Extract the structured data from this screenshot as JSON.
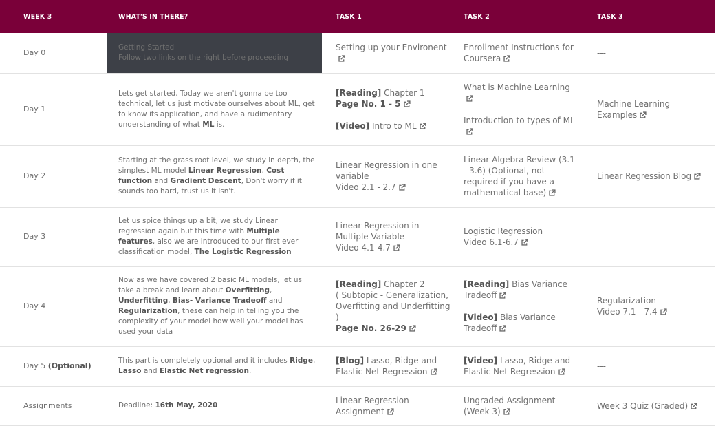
{
  "header": {
    "col0": "WEEK 3",
    "col1": "WHAT'S IN THERE?",
    "col2": "TASK 1",
    "col3": "TASK 2",
    "col4": "TASK 3"
  },
  "rows": [
    {
      "day": "Day 0",
      "what": [
        "Getting Started",
        "Follow two links on the right before proceeding"
      ],
      "task1": "Setting up your Environent",
      "task2": "Enrollment Instructions for Coursera",
      "task3": "---"
    },
    {
      "day": "Day 1",
      "what": [
        "Lets get started, Today we aren't gonna be too technical, let us just motivate ourselves about ML, get to know its application, and have a rudimentary understanding of what ",
        "ML",
        " is."
      ],
      "task1": {
        "a_tag": "[Reading]",
        "a_text": " Chapter 1",
        "a_bold": "Page No. 1 - 5",
        "b_tag": "[Video]",
        "b_text": " Intro to ML"
      },
      "task2": {
        "a": "What is Machine Learning",
        "b": "Introduction to types of ML"
      },
      "task3": "Machine Learning Examples"
    },
    {
      "day": "Day 2",
      "what": [
        "Starting at the grass root level, we study in depth, the simplest ML model ",
        "Linear Regression",
        ", ",
        "Cost function",
        " and ",
        "Gradient Descent",
        ", Don't worry if it sounds too hard, trust us it isn't."
      ],
      "task1": {
        "title": "Linear Regression in one variable",
        "sub": "Video 2.1 - 2.7"
      },
      "task2": "Linear Algebra Review (3.1 - 3.6) (Optional, not required if you have a mathematical base)",
      "task3": "Linear Regression Blog"
    },
    {
      "day": "Day 3",
      "what": [
        "Let us spice things up a bit, we study Linear regression again but this time with ",
        "Multiple features",
        ", also we are introduced to our first ever classification model, ",
        "The Logistic Regression"
      ],
      "task1": {
        "title": "Linear Regression in Multiple Variable",
        "sub": "Video 4.1-4.7"
      },
      "task2": {
        "title": "Logistic Regression",
        "sub": "Video 6.1-6.7"
      },
      "task3": "----"
    },
    {
      "day": "Day 4",
      "what": [
        "Now as we have covered 2 basic ML models, let us take a break and learn about ",
        "Overfitting",
        ", ",
        "Underfitting",
        ", ",
        "Bias- Variance Tradeoff",
        " and ",
        "Regularization",
        ", these can help in telling you the complexity of your model how well your model has used your data"
      ],
      "task1": {
        "tag": "[Reading]",
        "text": " Chapter 2",
        "sub": "( Subtopic - Generalization, Overfitting and Underfitting )",
        "bold": "Page No. 26-29"
      },
      "task2": {
        "a_tag": "[Reading]",
        "a_text": " Bias Variance Tradeoff",
        "b_tag": "[Video]",
        "b_text": " Bias Variance Tradeoff"
      },
      "task3": {
        "title": "Regularization",
        "sub": "Video 7.1 - 7.4"
      }
    },
    {
      "day_a": "Day 5 ",
      "day_b": "(Optional)",
      "what": [
        "This part is completely optional and it includes ",
        "Ridge",
        ", ",
        "Lasso",
        " and ",
        "Elastic Net regression",
        "."
      ],
      "task1": {
        "tag": "[Blog]",
        "text": " Lasso, Ridge and Elastic Net Regression"
      },
      "task2": {
        "tag": "[Video]",
        "text": " Lasso, Ridge and Elastic Net Regression"
      },
      "task3": "---"
    },
    {
      "day": "Assignments",
      "what": [
        "Deadline: ",
        "16th May, 2020"
      ],
      "task1": "Linear Regression Assignment",
      "task2": "Ungraded Assignment (Week 3)",
      "task3": "Week 3 Quiz (Graded)"
    }
  ],
  "icons": {
    "external_link": "external-link-icon"
  },
  "colors": {
    "header_bg": "#7a0039",
    "highlight_bg": "#3d4047"
  }
}
